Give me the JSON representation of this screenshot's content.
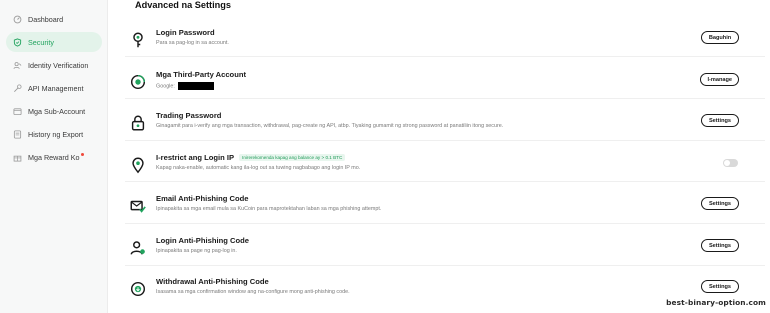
{
  "sidebar": {
    "items": [
      {
        "label": "Dashboard",
        "icon": "dashboard-icon"
      },
      {
        "label": "Security",
        "icon": "shield-icon",
        "active": true
      },
      {
        "label": "Identity Verification",
        "icon": "id-verify-icon"
      },
      {
        "label": "API Management",
        "icon": "api-icon"
      },
      {
        "label": "Mga Sub-Account",
        "icon": "sub-account-icon"
      },
      {
        "label": "History ng Export",
        "icon": "history-icon"
      },
      {
        "label": "Mga Reward Ko",
        "icon": "gift-icon",
        "notification": true
      }
    ]
  },
  "main": {
    "section_title": "Advanced na Settings",
    "rows": [
      {
        "title": "Login Password",
        "desc": "Para sa pag-log in sa account.",
        "action": "Baguhin",
        "icon": "key-icon"
      },
      {
        "title": "Mga Third-Party Account",
        "desc": "Google:",
        "action": "I-manage",
        "icon": "link-account-icon"
      },
      {
        "title": "Trading Password",
        "desc": "Ginagamit para i-verify ang mga transaction, withdrawal, pag-create ng API, atbp. Tiyaking gumamit ng strong password at panatiliin itong secure.",
        "action": "Settings",
        "icon": "lock-icon"
      },
      {
        "title": "I-restrict ang Login IP",
        "badge": "Inirerekomenda kapag ang balance ay > 0.1 BTC",
        "desc": "Kapag naka-enable, automatic kang ila-log out sa tuwing nagbabago ang login IP mo.",
        "toggle": false,
        "icon": "location-pin-icon"
      },
      {
        "title": "Email Anti-Phishing Code",
        "desc": "Ipinapakita sa mga email mula sa KuCoin para maprotektahan laban sa mga phishing attempt.",
        "action": "Settings",
        "icon": "mail-shield-icon"
      },
      {
        "title": "Login Anti-Phishing Code",
        "desc": "Ipinapakita sa page ng pag-log in.",
        "action": "Settings",
        "icon": "user-shield-icon"
      },
      {
        "title": "Withdrawal Anti-Phishing Code",
        "desc": "Isasama sa mga confirmation window ang na-configure mong anti-phishing code.",
        "action": "Settings",
        "icon": "withdraw-shield-icon"
      }
    ]
  },
  "watermark": "best-binary-option.com",
  "colors": {
    "accent": "#21a35e",
    "active_bg": "#e3f3ea",
    "sidebar_bg": "#f7f8f8",
    "badge_bg": "#e8f6ee",
    "notification": "#f0493b"
  }
}
